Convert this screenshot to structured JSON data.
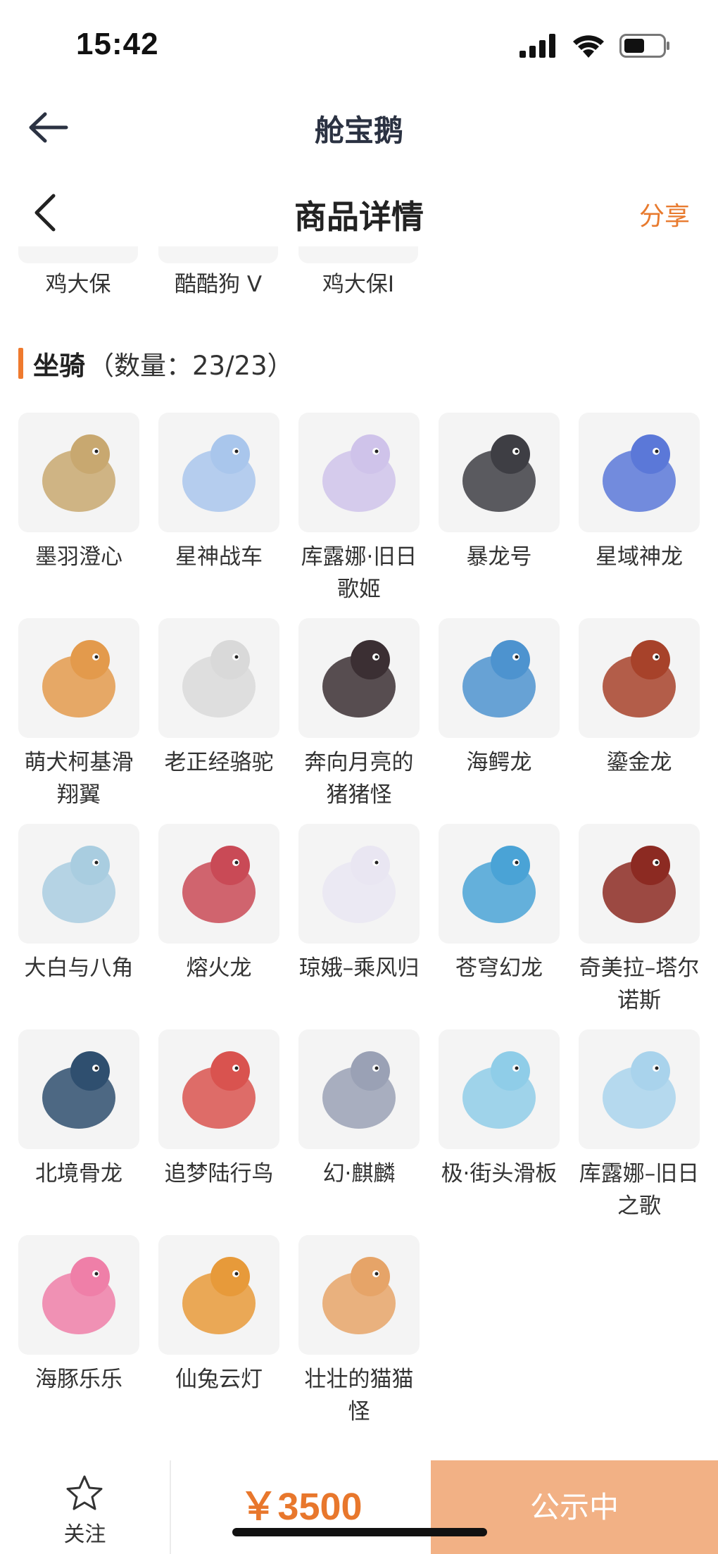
{
  "status_bar": {
    "time": "15:42",
    "icons": [
      "signal-icon",
      "wifi-icon",
      "battery-icon"
    ]
  },
  "app_header": {
    "title": "舱宝鹅",
    "back_icon": "arrow-left-icon"
  },
  "page_header": {
    "title": "商品详情",
    "share_label": "分享",
    "back_icon": "chevron-left-icon"
  },
  "prev_section": {
    "items": [
      "鸡大保",
      "酷酷狗 V",
      "鸡大保I"
    ]
  },
  "mounts_section": {
    "title": "坐骑",
    "count": "（数量：23/23）"
  },
  "mounts": [
    {
      "label": "墨羽澄心",
      "color": "#c8a870"
    },
    {
      "label": "星神战车",
      "color": "#a9c6ec"
    },
    {
      "label": "库露娜·旧日歌姬",
      "color": "#cfc3ea"
    },
    {
      "label": "暴龙号",
      "color": "#3e3e44"
    },
    {
      "label": "星域神龙",
      "color": "#5b78d8"
    },
    {
      "label": "萌犬柯基滑翔翼",
      "color": "#e39a4c"
    },
    {
      "label": "老正经骆驼",
      "color": "#d9d9d9"
    },
    {
      "label": "奔向月亮的猪猪怪",
      "color": "#3b2f33"
    },
    {
      "label": "海鳄龙",
      "color": "#4d93cf"
    },
    {
      "label": "鎏金龙",
      "color": "#a7422a"
    },
    {
      "label": "大白与八角",
      "color": "#a9cde0"
    },
    {
      "label": "熔火龙",
      "color": "#c94a56"
    },
    {
      "label": "琼娥–乘风归",
      "color": "#e9e6f2"
    },
    {
      "label": "苍穹幻龙",
      "color": "#4aa3d6"
    },
    {
      "label": "奇美拉–塔尔诺斯",
      "color": "#8c2a22"
    },
    {
      "label": "北境骨龙",
      "color": "#2f4f6f"
    },
    {
      "label": "追梦陆行鸟",
      "color": "#d9534f"
    },
    {
      "label": "幻·麒麟",
      "color": "#9aa1b5"
    },
    {
      "label": "极·街头滑板",
      "color": "#8fcde8"
    },
    {
      "label": "库露娜–旧日之歌",
      "color": "#a9d3ec"
    },
    {
      "label": "海豚乐乐",
      "color": "#ef7fa8"
    },
    {
      "label": "仙兔云灯",
      "color": "#e79a3a"
    },
    {
      "label": "壮壮的猫猫怪",
      "color": "#e6a468"
    }
  ],
  "bottom_bar": {
    "follow_label": "关注",
    "price": "￥3500",
    "status_label": "公示中"
  },
  "colors": {
    "accent": "#ef7a2e",
    "status_button": "#f2b185",
    "thumb_bg": "#f4f4f4"
  }
}
